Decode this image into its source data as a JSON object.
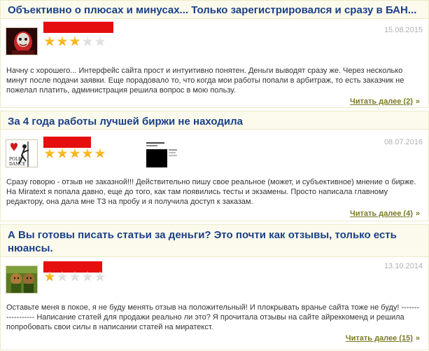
{
  "reviews": [
    {
      "title": "Объективно о плюсах и минусах... Только зарегистрировался и сразу в БАН...",
      "date": "15.08.2015",
      "rating": 3,
      "max_rating": 5,
      "text": "Начну с хорошего... Интерфейс сайта прост и интуитивно понятен. Деньги выводят сразу же. Через несколько минут после подачи заявки. Еще порадовало то, что когда мои работы попали в арбитраж, то есть заказчик не пожелал платить, администрация решила вопрос в мою пользу.",
      "read_more": "Читать далее (2)",
      "read_more_icon": "double-chevron-right-icon"
    },
    {
      "title": "За 4 года работы лучшей биржи не находила",
      "date": "08.07.2016",
      "rating": 5,
      "max_rating": 5,
      "avatar_caption": "POLE DANCE",
      "text": "Сразу говорю - отзыв не заказной!!! Действительно пишу свое реальное (может, и субъективное) мнение о бирже. На Miratext я попала давно, еще до того, как там появились тесты и экзамены. Просто написала главному редактору, она дала мне ТЗ на пробу и я получила доступ к заказам.",
      "read_more": "Читать далее (4)",
      "read_more_icon": "double-chevron-right-icon"
    },
    {
      "title": "А Вы готовы писать статьи за деньги? Это почти как отзывы, только есть нюансы.",
      "date": "13.10.2014",
      "rating": 1,
      "max_rating": 5,
      "text": "Оставьте меня в покое, я не буду менять отзыв на положительный!  И плокрывать вранье сайта тоже не буду!  ------------------ Написание статей для продажи реально ли это? Я прочитала отзывы на сайте айреккоменд и решила попробовать свои силы в написании статей на миратекст.",
      "read_more": "Читать далее (15)",
      "read_more_icon": "double-chevron-right-icon"
    }
  ],
  "colors": {
    "title": "#1a3f88",
    "read_more": "#7a7a22",
    "redaction": "#e60f0f",
    "star_on": "#f5b400",
    "star_off": "#d6d6d6",
    "header_bg": "#fbfaec",
    "border": "#ecebc8"
  }
}
